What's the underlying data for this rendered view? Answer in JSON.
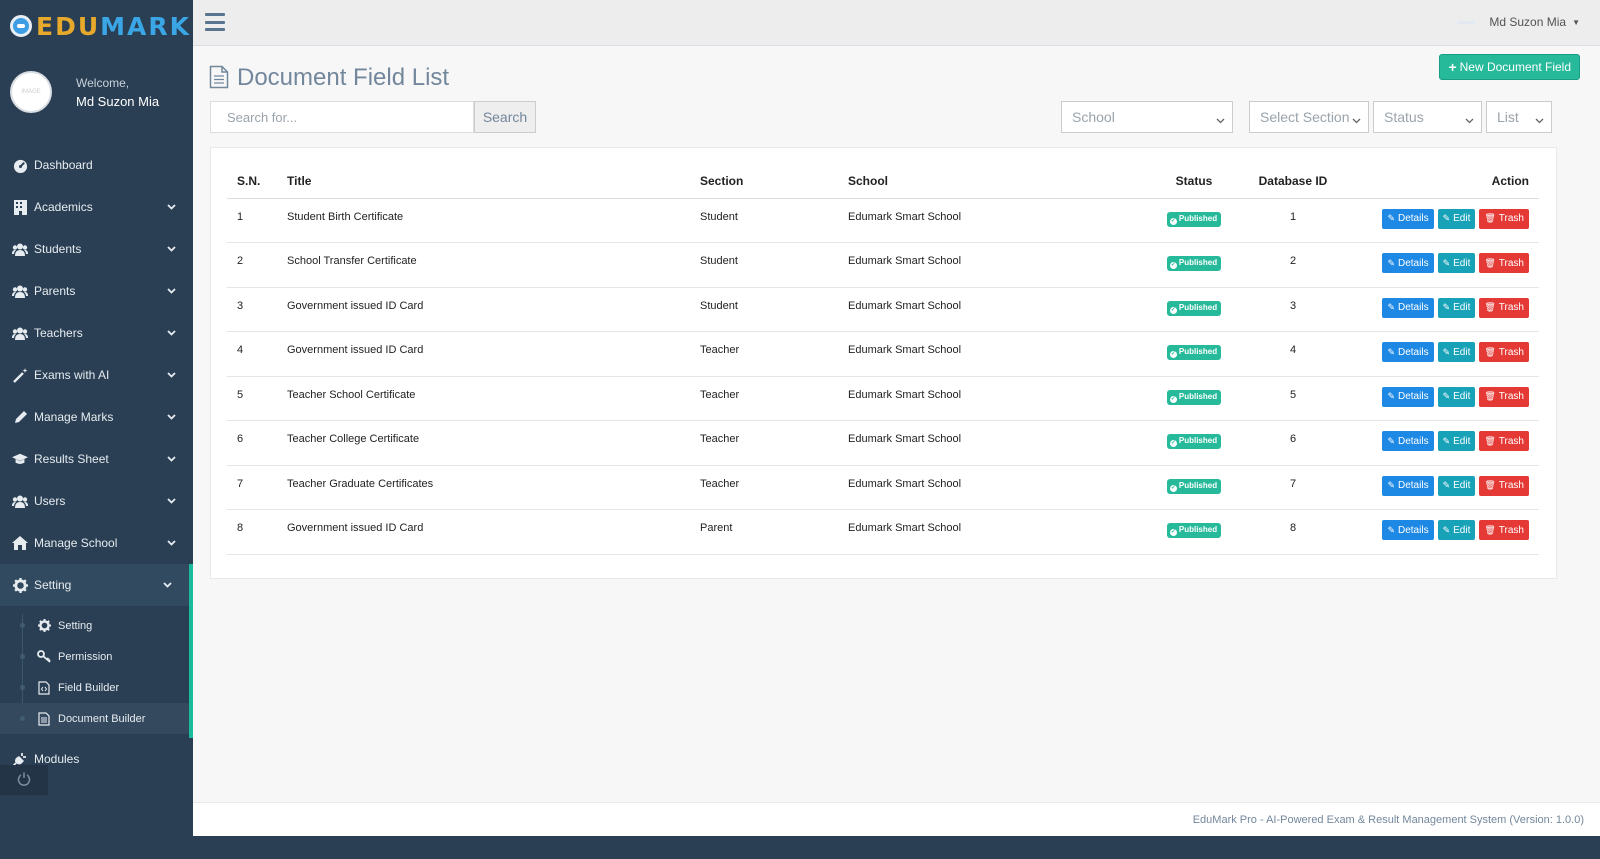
{
  "brand": {
    "part1": "EDU",
    "part2": "MARK"
  },
  "profile": {
    "avatar_text": "IMAGE",
    "welcome": "Welcome,",
    "name": "Md Suzon Mia"
  },
  "menu": [
    {
      "label": "Dashboard",
      "icon": "dashboard-icon"
    },
    {
      "label": "Academics",
      "icon": "building-icon"
    },
    {
      "label": "Students",
      "icon": "users-icon"
    },
    {
      "label": "Parents",
      "icon": "users-icon"
    },
    {
      "label": "Teachers",
      "icon": "users-icon"
    },
    {
      "label": "Exams with AI",
      "icon": "magic-wand-icon"
    },
    {
      "label": "Manage Marks",
      "icon": "pencil-icon"
    },
    {
      "label": "Results Sheet",
      "icon": "graduation-cap-icon"
    },
    {
      "label": "Users",
      "icon": "users-icon"
    },
    {
      "label": "Manage School",
      "icon": "home-icon"
    },
    {
      "label": "Setting",
      "icon": "gear-icon"
    }
  ],
  "submenu": [
    {
      "label": "Setting",
      "icon": "gear-icon"
    },
    {
      "label": "Permission",
      "icon": "key-icon"
    },
    {
      "label": "Field Builder",
      "icon": "code-file-icon"
    },
    {
      "label": "Document Builder",
      "icon": "document-icon"
    }
  ],
  "modules_label": "Modules",
  "topbar": {
    "user_name": "Md Suzon Mia"
  },
  "page": {
    "title": "Document Field List",
    "new_button": "New Document Field",
    "search_placeholder": "Search for...",
    "search_button": "Search",
    "filters": {
      "school": "School",
      "section": "Select Section",
      "status": "Status",
      "view": "List"
    }
  },
  "table": {
    "headers": {
      "sn": "S.N.",
      "title": "Title",
      "section": "Section",
      "school": "School",
      "status": "Status",
      "db": "Database ID",
      "action": "Action"
    },
    "buttons": {
      "details": "Details",
      "edit": "Edit",
      "trash": "Trash"
    },
    "rows": [
      {
        "sn": "1",
        "title": "Student Birth Certificate",
        "section": "Student",
        "school": "Edumark Smart School",
        "status": "Published",
        "db": "1"
      },
      {
        "sn": "2",
        "title": "School Transfer Certificate",
        "section": "Student",
        "school": "Edumark Smart School",
        "status": "Published",
        "db": "2"
      },
      {
        "sn": "3",
        "title": "Government issued ID Card",
        "section": "Student",
        "school": "Edumark Smart School",
        "status": "Published",
        "db": "3"
      },
      {
        "sn": "4",
        "title": "Government issued ID Card",
        "section": "Teacher",
        "school": "Edumark Smart School",
        "status": "Published",
        "db": "4"
      },
      {
        "sn": "5",
        "title": "Teacher School Certificate",
        "section": "Teacher",
        "school": "Edumark Smart School",
        "status": "Published",
        "db": "5"
      },
      {
        "sn": "6",
        "title": "Teacher College Certificate",
        "section": "Teacher",
        "school": "Edumark Smart School",
        "status": "Published",
        "db": "6"
      },
      {
        "sn": "7",
        "title": "Teacher Graduate Certificates",
        "section": "Teacher",
        "school": "Edumark Smart School",
        "status": "Published",
        "db": "7"
      },
      {
        "sn": "8",
        "title": "Government issued ID Card",
        "section": "Parent",
        "school": "Edumark Smart School",
        "status": "Published",
        "db": "8"
      }
    ]
  },
  "footer": "EduMark Pro - AI-Powered Exam & Result Management System (Version: 1.0.0)",
  "colors": {
    "sidebar": "#2a3f54",
    "accent": "#1abb9c",
    "success": "#26b99a",
    "details": "#1e88e5",
    "edit": "#17a2b8",
    "trash": "#e53935"
  }
}
